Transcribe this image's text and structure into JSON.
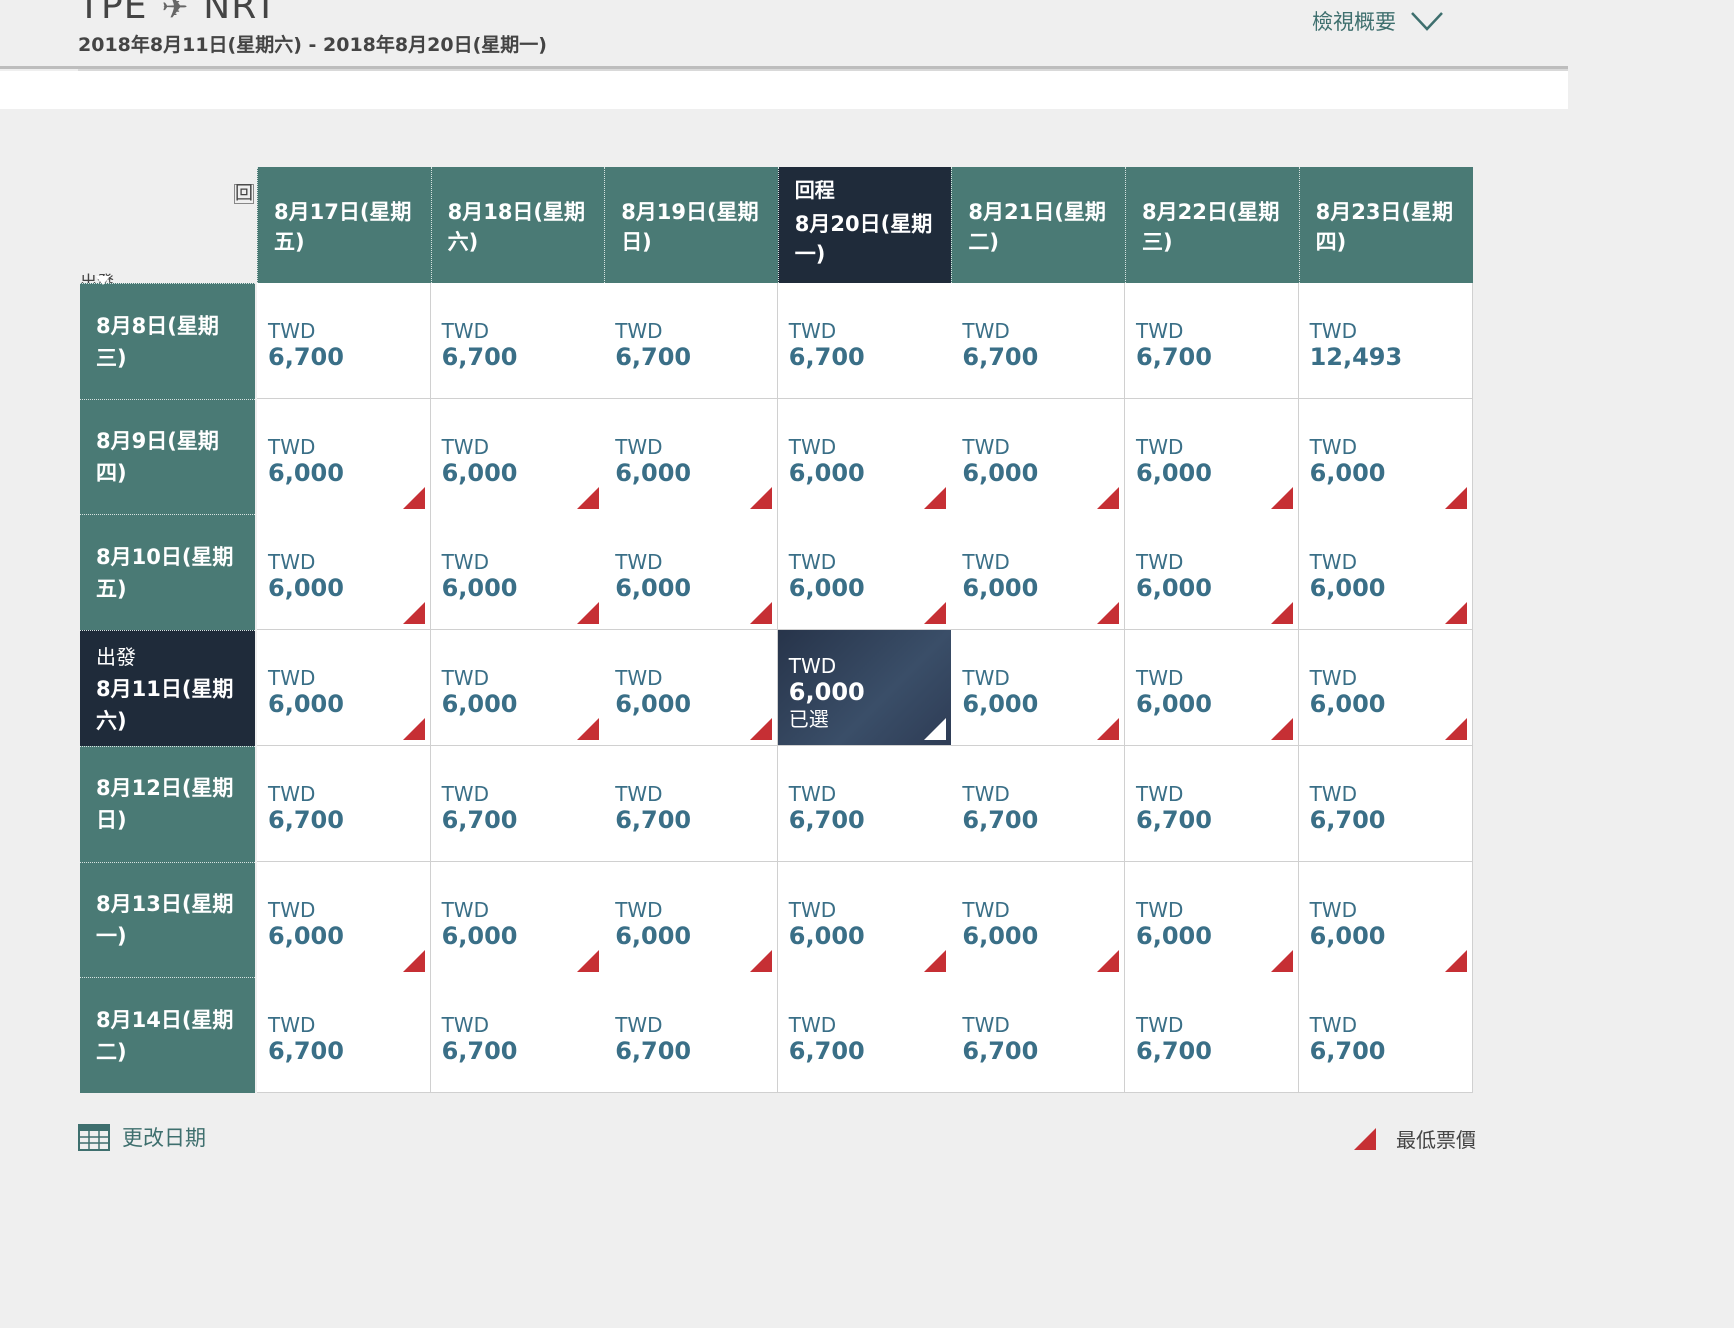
{
  "header": {
    "origin": "TPE",
    "destination": "NRT",
    "date_range": "2018年8月11日(星期六) - 2018年8月20日(星期一)",
    "summary_label": "檢視概要"
  },
  "grid": {
    "return_axis_label": "回",
    "depart_axis_label": "出發",
    "return_tag": "回程",
    "depart_tag": "出發",
    "currency": "TWD",
    "selected_label": "已選",
    "return_dates": [
      {
        "line1": "8月17日(星期",
        "line2": "五)",
        "selected": false
      },
      {
        "line1": "8月18日(星期",
        "line2": "六)",
        "selected": false
      },
      {
        "line1": "8月19日(星期",
        "line2": "日)",
        "selected": false
      },
      {
        "line1": "8月20日(星期",
        "line2": "一)",
        "selected": true
      },
      {
        "line1": "8月21日(星期",
        "line2": "二)",
        "selected": false
      },
      {
        "line1": "8月22日(星期",
        "line2": "三)",
        "selected": false
      },
      {
        "line1": "8月23日(星期",
        "line2": "四)",
        "selected": false
      }
    ],
    "rows": [
      {
        "line1": "8月8日(星期三)",
        "line2": "",
        "selected": false,
        "prices": [
          "6,700",
          "6,700",
          "6,700",
          "6,700",
          "6,700",
          "6,700",
          "12,493"
        ],
        "lowest": [
          false,
          false,
          false,
          false,
          false,
          false,
          false
        ]
      },
      {
        "line1": "8月9日(星期四)",
        "line2": "",
        "selected": false,
        "prices": [
          "6,000",
          "6,000",
          "6,000",
          "6,000",
          "6,000",
          "6,000",
          "6,000"
        ],
        "lowest": [
          true,
          true,
          true,
          true,
          true,
          true,
          true
        ]
      },
      {
        "line1": "8月10日(星期",
        "line2": "五)",
        "selected": false,
        "prices": [
          "6,000",
          "6,000",
          "6,000",
          "6,000",
          "6,000",
          "6,000",
          "6,000"
        ],
        "lowest": [
          true,
          true,
          true,
          true,
          true,
          true,
          true
        ]
      },
      {
        "line1": "8月11日(星期",
        "line2": "六)",
        "selected": true,
        "prices": [
          "6,000",
          "6,000",
          "6,000",
          "6,000",
          "6,000",
          "6,000",
          "6,000"
        ],
        "lowest": [
          true,
          true,
          true,
          true,
          true,
          true,
          true
        ]
      },
      {
        "line1": "8月12日(星期",
        "line2": "日)",
        "selected": false,
        "prices": [
          "6,700",
          "6,700",
          "6,700",
          "6,700",
          "6,700",
          "6,700",
          "6,700"
        ],
        "lowest": [
          false,
          false,
          false,
          false,
          false,
          false,
          false
        ]
      },
      {
        "line1": "8月13日(星期",
        "line2": "一)",
        "selected": false,
        "prices": [
          "6,000",
          "6,000",
          "6,000",
          "6,000",
          "6,000",
          "6,000",
          "6,000"
        ],
        "lowest": [
          true,
          true,
          true,
          true,
          true,
          true,
          true
        ]
      },
      {
        "line1": "8月14日(星期",
        "line2": "二)",
        "selected": false,
        "prices": [
          "6,700",
          "6,700",
          "6,700",
          "6,700",
          "6,700",
          "6,700",
          "6,700"
        ],
        "lowest": [
          false,
          false,
          false,
          false,
          false,
          false,
          false
        ]
      }
    ]
  },
  "footer": {
    "change_dates_label": "更改日期",
    "legend_label": "最低票價"
  },
  "colors": {
    "header_teal": "#4a7a75",
    "selected_navy": "#1f2b3a",
    "price_blue": "#3a6f87",
    "lowest_red": "#c62f34",
    "link_teal": "#3e6f6e"
  },
  "icons": {
    "plane": "plane-icon",
    "expand": "chevron-down-icon",
    "calendar": "calendar-icon",
    "lowest_fare": "lowest-fare-triangle-icon"
  }
}
